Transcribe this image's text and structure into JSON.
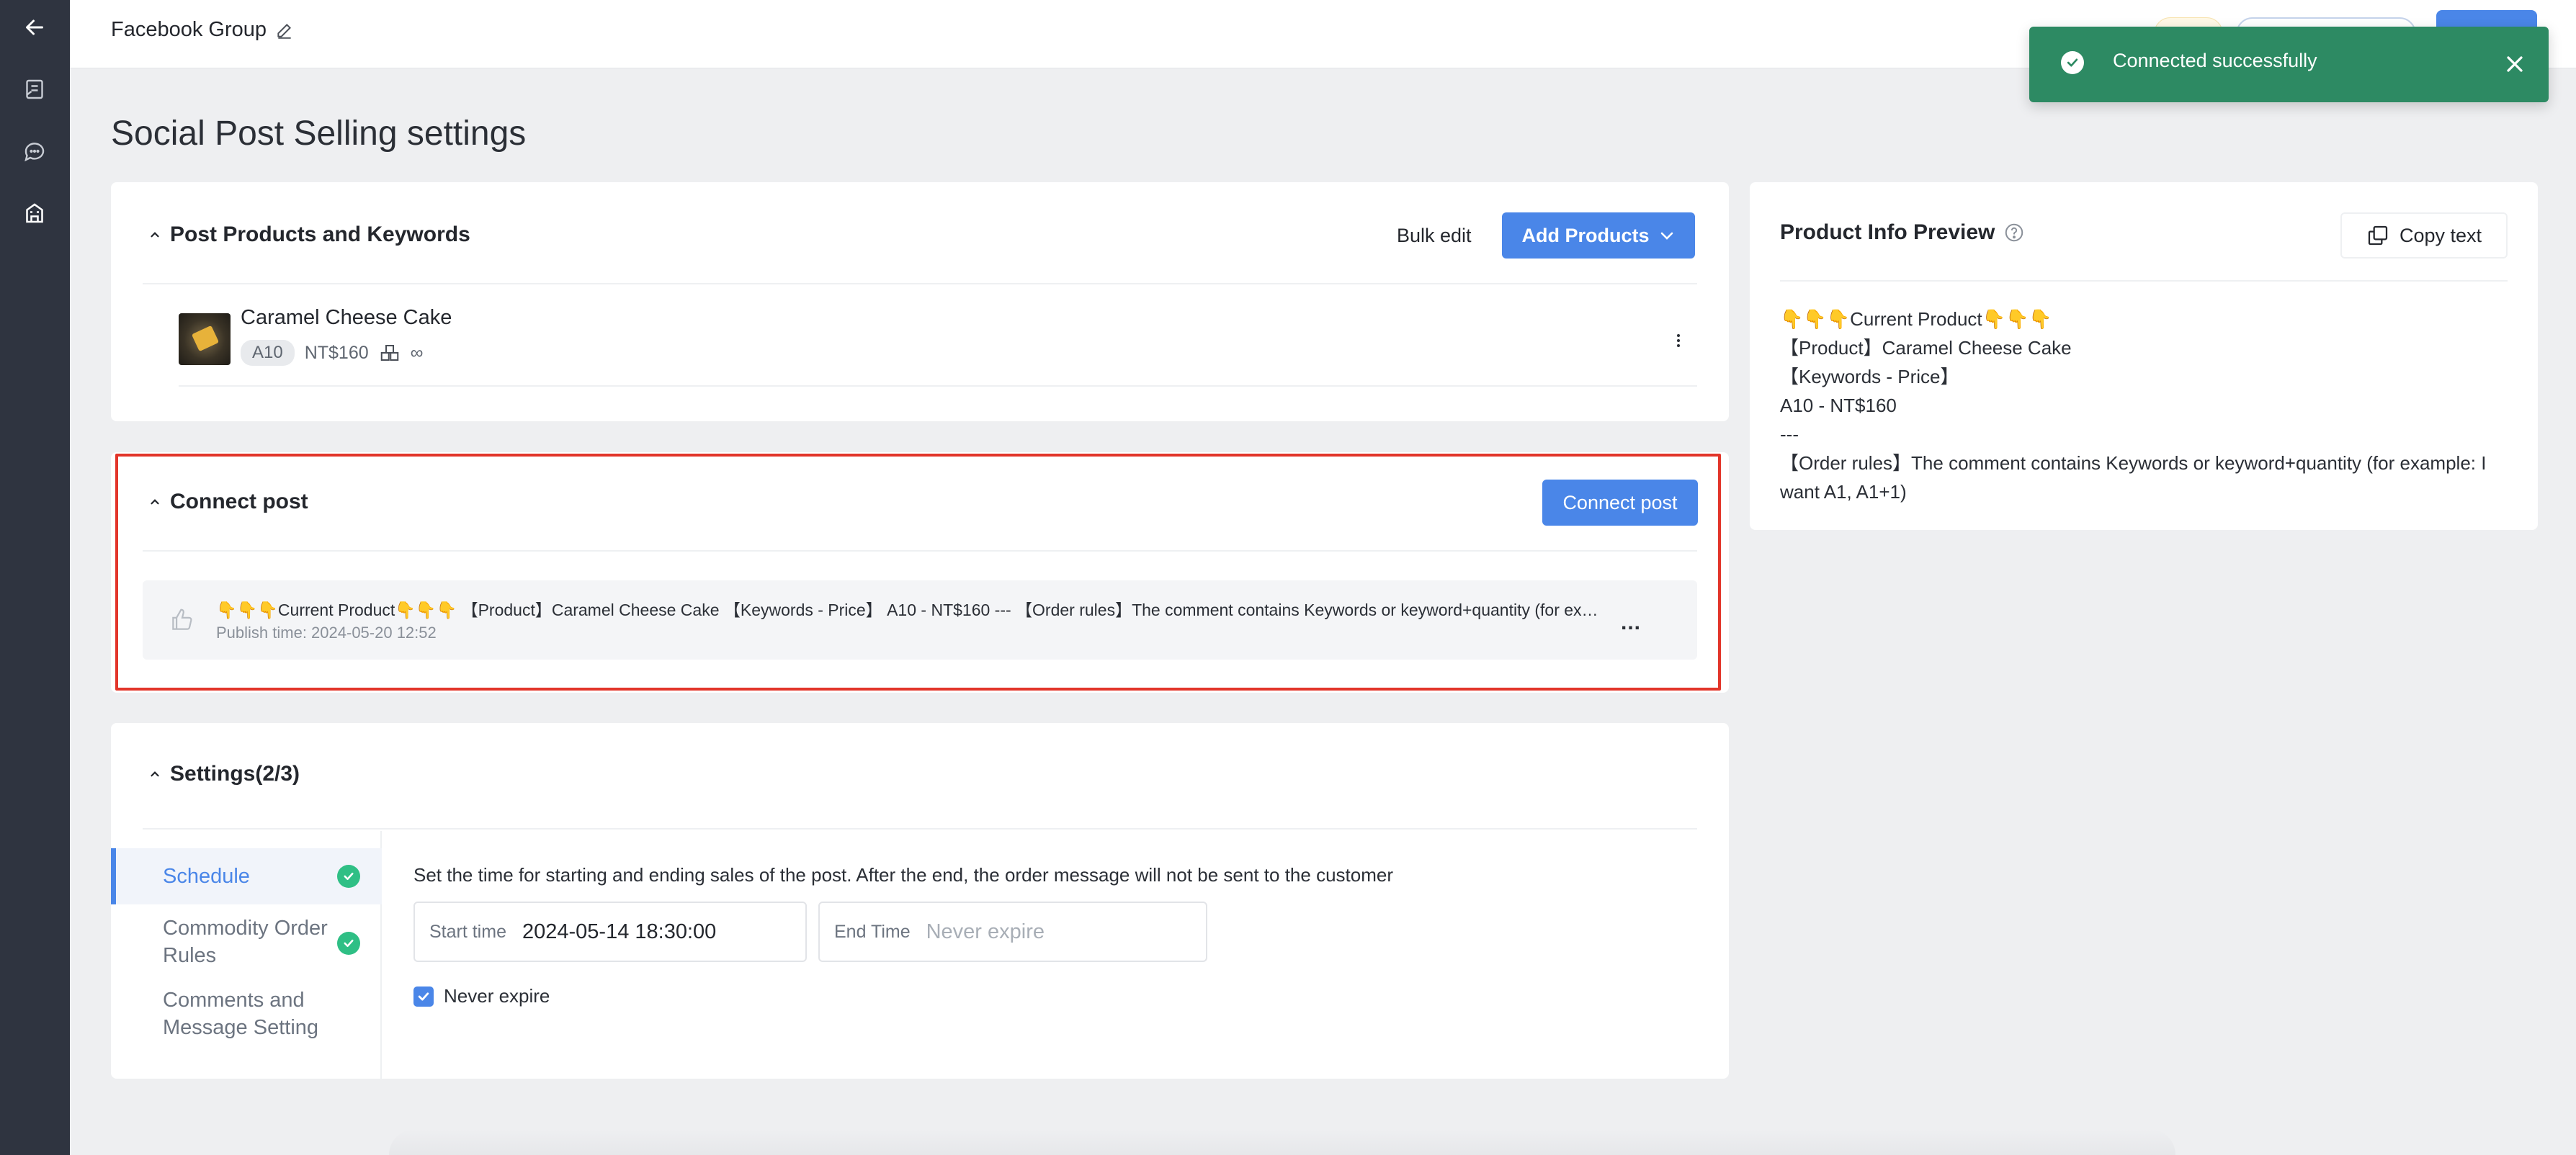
{
  "topbar": {
    "title": "Facebook Group"
  },
  "toast": {
    "message": "Connected successfully"
  },
  "page": {
    "title": "Social Post Selling settings"
  },
  "products": {
    "section_title": "Post Products and Keywords",
    "bulk_edit_label": "Bulk edit",
    "add_products_label": "Add Products",
    "items": [
      {
        "name": "Caramel Cheese Cake",
        "keyword": "A10",
        "price": "NT$160",
        "stock": "∞"
      }
    ]
  },
  "connect": {
    "section_title": "Connect post",
    "connect_button_label": "Connect post",
    "post": {
      "text": "👇👇👇Current Product👇👇👇 【Product】Caramel Cheese Cake 【Keywords - Price】 A10 - NT$160 --- 【Order rules】The comment contains Keywords or keyword+quantity (for exampl...",
      "publish_time": "Publish time: 2024-05-20 12:52",
      "more_label": "..."
    }
  },
  "settings": {
    "section_title": "Settings(2/3)",
    "nav": [
      {
        "label": "Schedule",
        "complete": true,
        "active": true
      },
      {
        "label": "Commodity Order Rules",
        "complete": true,
        "active": false
      },
      {
        "label": "Comments and Message Setting",
        "complete": false,
        "active": false
      }
    ],
    "schedule": {
      "description": "Set the time for starting and ending sales of the post. After the end, the order message will not be sent to the customer",
      "start_label": "Start time",
      "start_value": "2024-05-14 18:30:00",
      "end_label": "End Time",
      "end_placeholder": "Never expire",
      "never_expire_label": "Never expire",
      "never_expire_checked": true
    }
  },
  "preview": {
    "title": "Product Info Preview",
    "copy_label": "Copy text",
    "lines": [
      "👇👇👇Current Product👇👇👇",
      "【Product】Caramel Cheese Cake",
      "【Keywords - Price】",
      "A10 - NT$160",
      "---",
      "【Order rules】The comment contains Keywords or keyword+quantity (for example: I want A1, A1+1)"
    ]
  },
  "colors": {
    "accent": "#4a86e8",
    "success": "#2d8a63",
    "check_green": "#2fbf85",
    "highlight": "#e2352a",
    "rail": "#2f3440"
  },
  "icons": {
    "rail": [
      "back-arrow-icon",
      "post-document-icon",
      "chat-bubble-icon",
      "store-building-icon"
    ],
    "topbar": "pencil-edit-icon",
    "toast": [
      "check-circle-icon",
      "close-icon"
    ]
  }
}
